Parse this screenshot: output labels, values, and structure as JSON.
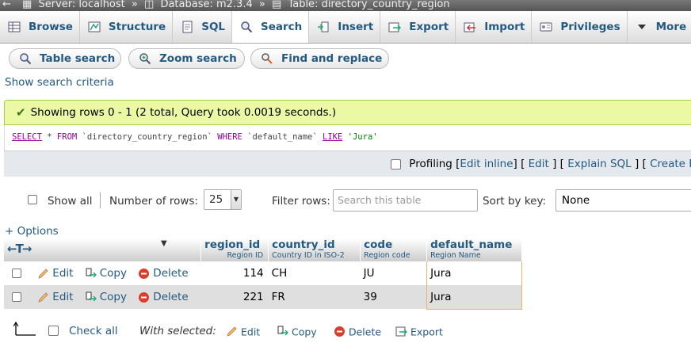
{
  "breadcrumb": {
    "server": "Server: localhost",
    "database": "Database: m2.3.4",
    "table": "Table: directory_country_region",
    "separator": "»"
  },
  "tabs": [
    {
      "label": "Browse",
      "icon": "browse-icon"
    },
    {
      "label": "Structure",
      "icon": "structure-icon"
    },
    {
      "label": "SQL",
      "icon": "sql-icon"
    },
    {
      "label": "Search",
      "icon": "search-icon",
      "active": true
    },
    {
      "label": "Insert",
      "icon": "insert-icon"
    },
    {
      "label": "Export",
      "icon": "export-icon"
    },
    {
      "label": "Import",
      "icon": "import-icon"
    },
    {
      "label": "Privileges",
      "icon": "privileges-icon"
    },
    {
      "label": "More",
      "icon": "chevron-down-icon"
    }
  ],
  "subtabs": {
    "table_search": "Table search",
    "zoom_search": "Zoom search",
    "find_replace": "Find and replace"
  },
  "show_search_criteria": "Show search criteria",
  "success_message": "Showing rows 0 - 1 (2 total, Query took 0.0019 seconds.)",
  "sql": {
    "select": "SELECT",
    "star": "*",
    "from": "FROM",
    "table": "`directory_country_region`",
    "where": "WHERE",
    "column": "`default_name`",
    "like": "LIKE",
    "value": "'Jura'"
  },
  "sql_tools": {
    "profiling": "Profiling",
    "edit_inline": "Edit inline",
    "edit": "Edit",
    "explain_sql": "Explain SQL",
    "create_php": "Create PH"
  },
  "nav": {
    "show_all": "Show all",
    "number_of_rows_label": "Number of rows:",
    "number_of_rows_value": "25",
    "filter_label": "Filter rows:",
    "filter_placeholder": "Search this table",
    "sort_label": "Sort by key:",
    "sort_value": "None"
  },
  "options_link": "+ Options",
  "table": {
    "columns": [
      {
        "name": "region_id",
        "comment": "Region ID"
      },
      {
        "name": "country_id",
        "comment": "Country ID in ISO-2"
      },
      {
        "name": "code",
        "comment": "Region code"
      },
      {
        "name": "default_name",
        "comment": "Region Name"
      }
    ],
    "actions": {
      "edit": "Edit",
      "copy": "Copy",
      "delete": "Delete"
    },
    "rows": [
      {
        "region_id": "114",
        "country_id": "CH",
        "code": "JU",
        "default_name": "Jura"
      },
      {
        "region_id": "221",
        "country_id": "FR",
        "code": "39",
        "default_name": "Jura"
      }
    ]
  },
  "bottom": {
    "check_all": "Check all",
    "with_selected": "With selected:",
    "edit": "Edit",
    "copy": "Copy",
    "delete": "Delete",
    "export": "Export"
  },
  "colors": {
    "link": "#235a81",
    "success_bg": "#ebf8a4",
    "highlight_border": "#f2b462",
    "delete_icon": "#d9402b"
  }
}
